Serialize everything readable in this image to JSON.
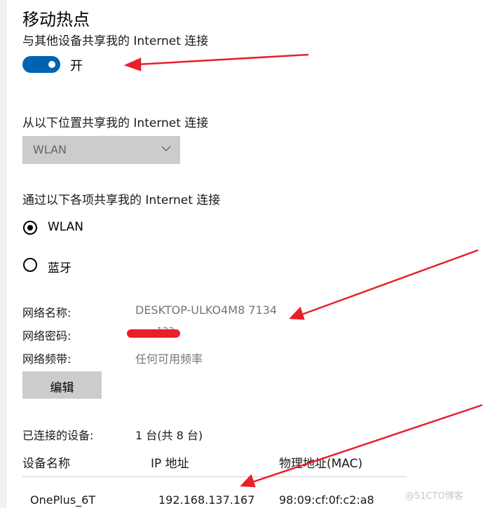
{
  "title": "移动热点",
  "share_label": "与其他设备共享我的 Internet 连接",
  "toggle": {
    "state_text": "开",
    "on": true
  },
  "source_label": "从以下位置共享我的 Internet 连接",
  "source_dropdown": {
    "value": "WLAN"
  },
  "share_via_label": "通过以下各项共享我的 Internet 连接",
  "share_via_options": [
    {
      "label": "WLAN",
      "selected": true
    },
    {
      "label": "蓝牙",
      "selected": false
    }
  ],
  "network": {
    "name_label": "网络名称:",
    "name_value": "DESKTOP-ULKO4M8 7134",
    "password_label": "网络密码:",
    "password_value": "••••123",
    "band_label": "网络频带:",
    "band_value": "任何可用频率"
  },
  "edit_button": "编辑",
  "connected": {
    "label": "已连接的设备:",
    "value": "1 台(共 8 台)"
  },
  "devices_table": {
    "headers": [
      "设备名称",
      "IP 地址",
      "物理地址(MAC)"
    ],
    "rows": [
      [
        "OnePlus_6T",
        "192.168.137.167",
        "98:09:cf:0f:c2:a8"
      ]
    ]
  },
  "watermark": "@51CTO博客",
  "colors": {
    "accent": "#0063b1",
    "annotation_arrow": "#e8202a",
    "disabled_bg": "#cccccc"
  }
}
